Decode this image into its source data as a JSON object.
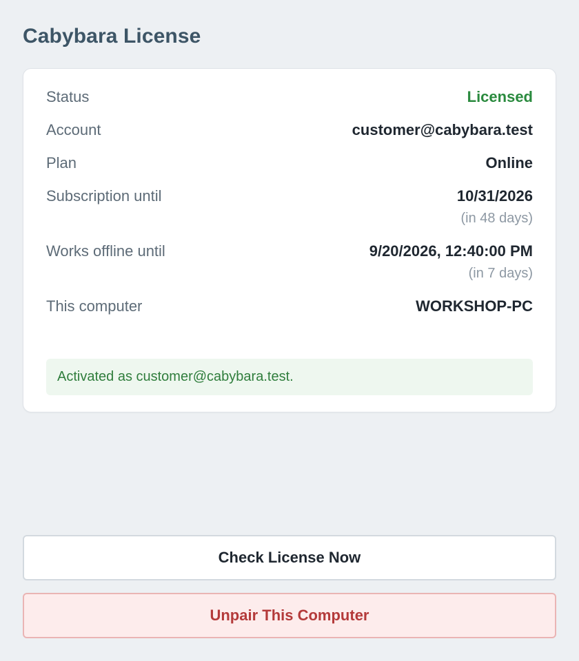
{
  "page": {
    "title": "Cabybara License"
  },
  "license": {
    "status_label": "Status",
    "status_value": "Licensed",
    "account_label": "Account",
    "account_value": "customer@cabybara.test",
    "plan_label": "Plan",
    "plan_value": "Online",
    "subscription_label": "Subscription until",
    "subscription_value": "10/31/2026",
    "subscription_relative": "(in 48 days)",
    "offline_label": "Works offline until",
    "offline_value": "9/20/2026, 12:40:00 PM",
    "offline_relative": "(in 7 days)",
    "computer_label": "This computer",
    "computer_value": "WORKSHOP-PC",
    "notice": "Activated as customer@cabybara.test."
  },
  "actions": {
    "check_label": "Check License Now",
    "unpair_label": "Unpair This Computer"
  },
  "colors": {
    "background": "#edf0f3",
    "title": "#3d5566",
    "status_ok": "#2a8a3e",
    "notice_bg": "#eef7ef",
    "danger": "#b43a3a",
    "danger_bg": "#fdecec"
  }
}
